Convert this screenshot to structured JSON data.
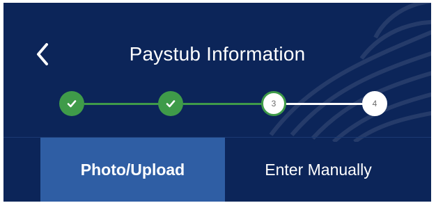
{
  "header": {
    "title": "Paystub Information",
    "back_icon": "chevron-left-icon"
  },
  "stepper": {
    "steps": [
      {
        "status": "complete",
        "label": ""
      },
      {
        "status": "complete",
        "label": ""
      },
      {
        "status": "current",
        "label": "3"
      },
      {
        "status": "pending",
        "label": "4"
      }
    ],
    "completed_color": "#3f9b49",
    "pending_line_color": "#ffffff"
  },
  "tabs": [
    {
      "label": "Photo/Upload",
      "active": true
    },
    {
      "label": "Enter Manually",
      "active": false
    }
  ],
  "colors": {
    "background": "#0c2559",
    "active_tab": "#2f5ea4"
  }
}
